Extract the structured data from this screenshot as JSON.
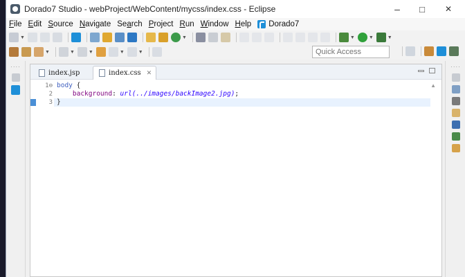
{
  "window": {
    "title": "Dorado7 Studio - webProject/WebContent/mycss/index.css - Eclipse",
    "controls": {
      "minimize": "–",
      "maximize": "□",
      "close": "✕"
    }
  },
  "menubar": {
    "items": [
      {
        "label": "File",
        "mnemonic": "F",
        "rest": "ile"
      },
      {
        "label": "Edit",
        "mnemonic": "E",
        "rest": "dit"
      },
      {
        "label": "Source",
        "mnemonic": "S",
        "rest": "ource"
      },
      {
        "label": "Navigate",
        "mnemonic": "N",
        "rest": "avigate"
      },
      {
        "label": "Search",
        "pre": "Se",
        "mnemonic": "a",
        "rest": "rch"
      },
      {
        "label": "Project",
        "mnemonic": "P",
        "rest": "roject"
      },
      {
        "label": "Run",
        "mnemonic": "R",
        "rest": "un"
      },
      {
        "label": "Window",
        "mnemonic": "W",
        "rest": "indow"
      },
      {
        "label": "Help",
        "mnemonic": "H",
        "rest": "elp"
      }
    ],
    "dorado": "Dorado7"
  },
  "toolbar": {
    "quick_access_placeholder": "Quick Access"
  },
  "editor": {
    "tabs": [
      {
        "label": "index.jsp",
        "active": false
      },
      {
        "label": "index.css",
        "active": true,
        "close": "✕"
      }
    ],
    "fold_marker": "⊖",
    "lines": [
      {
        "number": "1",
        "selector": "body",
        "brace": " {"
      },
      {
        "number": "2",
        "property": "background",
        "colon": ": ",
        "value": "url(../images/backImage2.jpg)",
        "semi": ";"
      },
      {
        "number": "3",
        "brace": "}"
      }
    ]
  },
  "colors": {
    "accent": "#1e8fd8",
    "current_line": "#e8f2fe",
    "css_selector": "#3f5fbf",
    "css_property": "#7f007f",
    "css_value": "#2a00ff"
  }
}
